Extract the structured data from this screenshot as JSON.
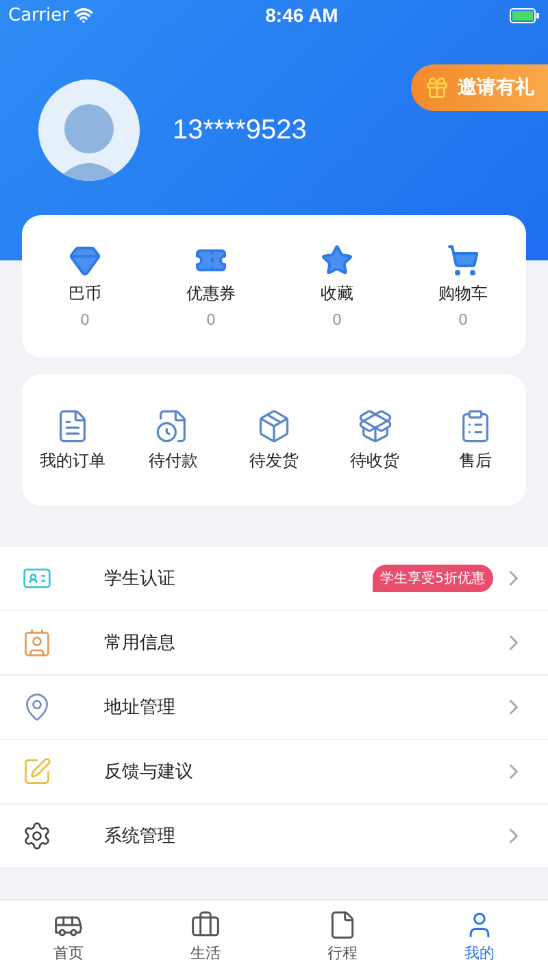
{
  "status_bar": {
    "carrier": "Carrier",
    "time": "8:46 AM"
  },
  "profile": {
    "phone": "13****9523",
    "invite": "邀请有礼"
  },
  "assets": [
    {
      "label": "巴币",
      "count": "0"
    },
    {
      "label": "优惠券",
      "count": "0"
    },
    {
      "label": "收藏",
      "count": "0"
    },
    {
      "label": "购物车",
      "count": "0"
    }
  ],
  "orders": [
    {
      "label": "我的订单"
    },
    {
      "label": "待付款"
    },
    {
      "label": "待发货"
    },
    {
      "label": "待收货"
    },
    {
      "label": "售后"
    }
  ],
  "menu": [
    {
      "label": "学生认证",
      "badge": "学生享受5折优惠"
    },
    {
      "label": "常用信息"
    },
    {
      "label": "地址管理"
    },
    {
      "label": "反馈与建议"
    },
    {
      "label": "系统管理"
    }
  ],
  "tab_bar": [
    {
      "label": "首页",
      "selected": false
    },
    {
      "label": "生活",
      "selected": false
    },
    {
      "label": "行程",
      "selected": false
    },
    {
      "label": "我的",
      "selected": true
    }
  ]
}
